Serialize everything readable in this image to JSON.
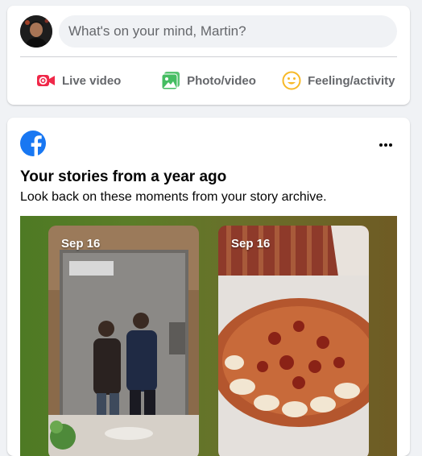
{
  "composer": {
    "placeholder": "What's on your mind, Martin?",
    "actions": [
      {
        "label": "Live video",
        "icon": "live-video-icon",
        "color": "#f02849"
      },
      {
        "label": "Photo/video",
        "icon": "photo-video-icon",
        "color": "#45bd62"
      },
      {
        "label": "Feeling/activity",
        "icon": "feeling-activity-icon",
        "color": "#f7b928"
      }
    ]
  },
  "memories": {
    "logo_icon": "facebook-logo-icon",
    "more_icon": "more-options-icon",
    "title": "Your stories from a year ago",
    "subtitle": "Look back on these moments from your story archive.",
    "stories": [
      {
        "date": "Sep 16"
      },
      {
        "date": "Sep 16"
      }
    ]
  },
  "colors": {
    "brand": "#1877f2",
    "page_bg": "#f0f2f5",
    "text_secondary": "#65676b"
  }
}
